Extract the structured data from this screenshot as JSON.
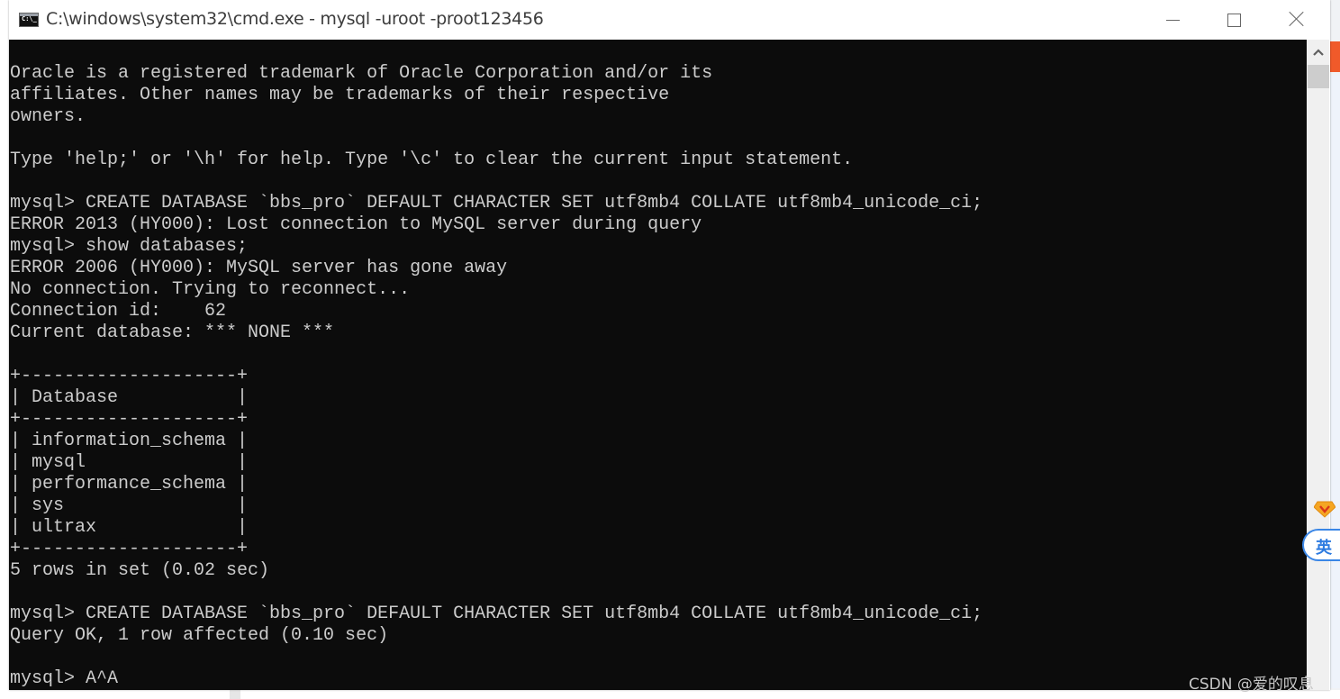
{
  "window": {
    "title": "C:\\windows\\system32\\cmd.exe - mysql  -uroot -proot123456",
    "icon": "cmd-icon",
    "icon_text": "C:\\_",
    "buttons": {
      "minimize": "minimize-icon",
      "maximize": "maximize-icon",
      "close": "close-icon"
    }
  },
  "console": {
    "lines": [
      "Oracle is a registered trademark of Oracle Corporation and/or its",
      "affiliates. Other names may be trademarks of their respective",
      "owners.",
      "",
      "Type 'help;' or '\\h' for help. Type '\\c' to clear the current input statement.",
      "",
      "mysql> CREATE DATABASE `bbs_pro` DEFAULT CHARACTER SET utf8mb4 COLLATE utf8mb4_unicode_ci;",
      "ERROR 2013 (HY000): Lost connection to MySQL server during query",
      "mysql> show databases;",
      "ERROR 2006 (HY000): MySQL server has gone away",
      "No connection. Trying to reconnect...",
      "Connection id:    62",
      "Current database: *** NONE ***",
      "",
      "+--------------------+",
      "| Database           |",
      "+--------------------+",
      "| information_schema |",
      "| mysql              |",
      "| performance_schema |",
      "| sys                |",
      "| ultrax             |",
      "+--------------------+",
      "5 rows in set (0.02 sec)",
      "",
      "mysql> CREATE DATABASE `bbs_pro` DEFAULT CHARACTER SET utf8mb4 COLLATE utf8mb4_unicode_ci;",
      "Query OK, 1 row affected (0.10 sec)",
      "",
      "mysql> A^A"
    ],
    "colors": {
      "background": "#0c0c0c",
      "foreground": "#cccccc"
    }
  },
  "scrollbar": {
    "up_arrow": "^"
  },
  "ime": {
    "indicator": "英",
    "gem_icon": "sogou-gem-icon"
  },
  "watermark": "CSDN @爱的叹息"
}
